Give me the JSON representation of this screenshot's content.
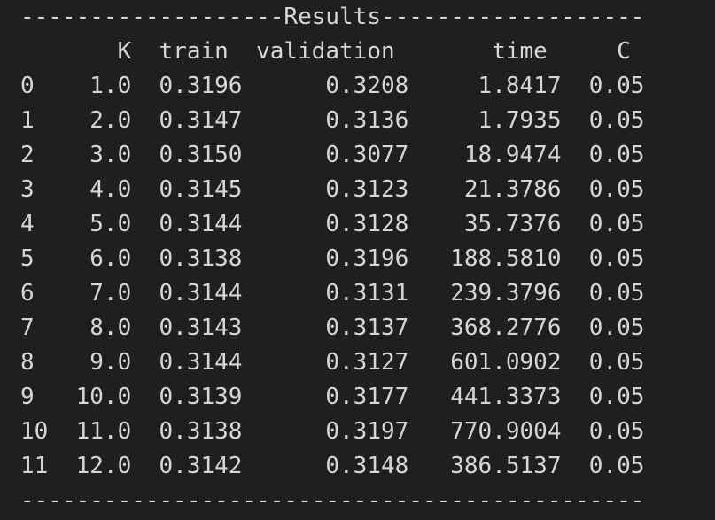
{
  "output": {
    "header_rule": "-------------------Results-------------------",
    "column_header": "       K  train  validation       time     C",
    "rows": [
      "0    1.0  0.3196      0.3208     1.8417  0.05",
      "1    2.0  0.3147      0.3136     1.7935  0.05",
      "2    3.0  0.3150      0.3077    18.9474  0.05",
      "3    4.0  0.3145      0.3123    21.3786  0.05",
      "4    5.0  0.3144      0.3128    35.7376  0.05",
      "5    6.0  0.3138      0.3196   188.5810  0.05",
      "6    7.0  0.3144      0.3131   239.3796  0.05",
      "7    8.0  0.3143      0.3137   368.2776  0.05",
      "8    9.0  0.3144      0.3127   601.0902  0.05",
      "9   10.0  0.3139      0.3177   441.3373  0.05",
      "10  11.0  0.3138      0.3197   770.9004  0.05",
      "11  12.0  0.3142      0.3148   386.5137  0.05"
    ],
    "footer_rule": "---------------------------------------------"
  },
  "colors": {
    "background": "#1f1f1f",
    "text": "#d6d6d6"
  }
}
